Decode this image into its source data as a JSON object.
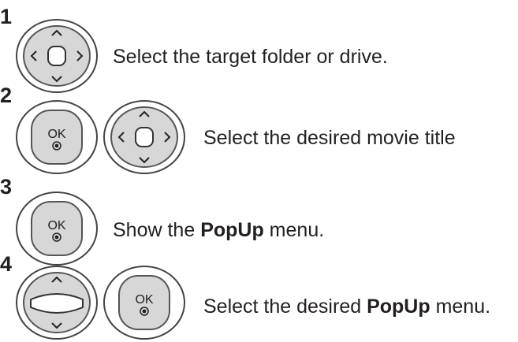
{
  "steps": [
    {
      "number": "1",
      "text": "Select the target folder or drive.",
      "buttons": [
        "nav-pad-icon"
      ]
    },
    {
      "number": "2",
      "text": "Select the desired movie title",
      "buttons": [
        "ok-button-icon",
        "nav-pad-icon"
      ]
    },
    {
      "number": "3",
      "text_before": "Show the ",
      "text_bold": "PopUp",
      "text_after": " menu.",
      "buttons": [
        "ok-button-icon"
      ]
    },
    {
      "number": "4",
      "text_before": "Select the desired ",
      "text_bold": "PopUp",
      "text_after": " menu.",
      "buttons": [
        "up-down-pad-icon",
        "ok-button-icon"
      ]
    }
  ],
  "ok_label": "OK",
  "colors": {
    "text": "#231f20",
    "button_fill": "#d9d9d9",
    "button_outline": "#555555"
  }
}
